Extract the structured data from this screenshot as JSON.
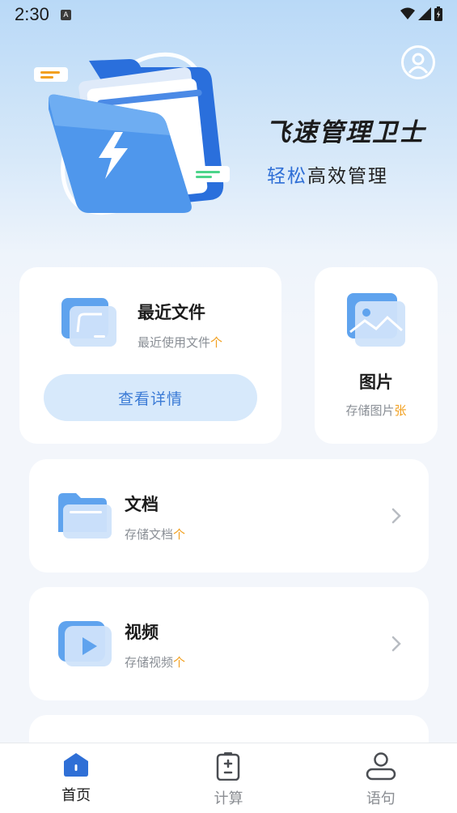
{
  "status_bar": {
    "time": "2:30",
    "notification_badge": "A"
  },
  "header": {
    "app_title": "飞速管理卫士",
    "subtitle_accent": "轻松",
    "subtitle_rest": "高效管理"
  },
  "cards": {
    "recent": {
      "title": "最近文件",
      "sub_text": "最近使用文件",
      "unit": "个",
      "button_label": "查看详情"
    },
    "photos": {
      "title": "图片",
      "sub_text": "存储图片",
      "unit": "张"
    },
    "documents": {
      "title": "文档",
      "sub_text": "存储文档",
      "unit": "个"
    },
    "videos": {
      "title": "视频",
      "sub_text": "存储视频",
      "unit": "个"
    }
  },
  "bottom_nav": {
    "items": [
      {
        "label": "首页",
        "icon": "home-icon",
        "active": true
      },
      {
        "label": "计算",
        "icon": "calculator-icon",
        "active": false
      },
      {
        "label": "语句",
        "icon": "person-icon",
        "active": false
      }
    ]
  },
  "colors": {
    "accent_blue": "#2f6fd6",
    "unit_orange": "#f2a020",
    "button_bg": "#d7e9fb"
  }
}
